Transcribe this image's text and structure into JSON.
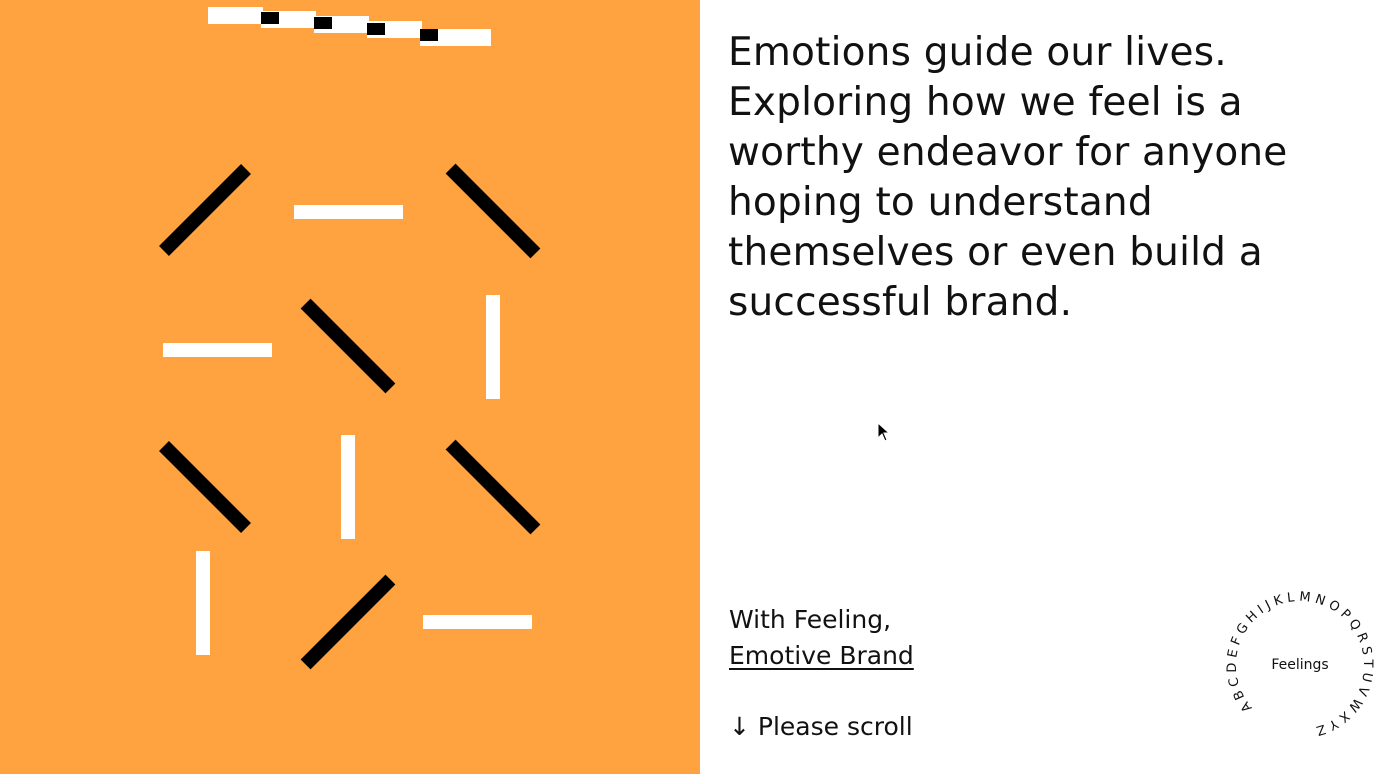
{
  "colors": {
    "art_background": "#FFA240",
    "page_background": "#FFFFFF",
    "text": "#111111",
    "dark_bar": "#000000",
    "light_bar": "#FFFFFF"
  },
  "headline": {
    "lines": [
      "Emotions guide our lives.",
      "Exploring how we feel is a",
      "worthy endeavor for anyone",
      "hoping to understand",
      "themselves or even build a",
      "successful brand."
    ]
  },
  "byline": {
    "prefix": "With Feeling,",
    "link_label": "Emotive Brand"
  },
  "scroll_hint": {
    "arrow": "↓",
    "label": "Please scroll"
  },
  "badge": {
    "ring_text": "ABCDEFGHIJKLMNOPQRSTUVWXYZ",
    "center_label": "Feelings"
  },
  "icons": {
    "cursor": "arrow-cursor-icon",
    "scroll_arrow": "down-arrow-icon"
  }
}
